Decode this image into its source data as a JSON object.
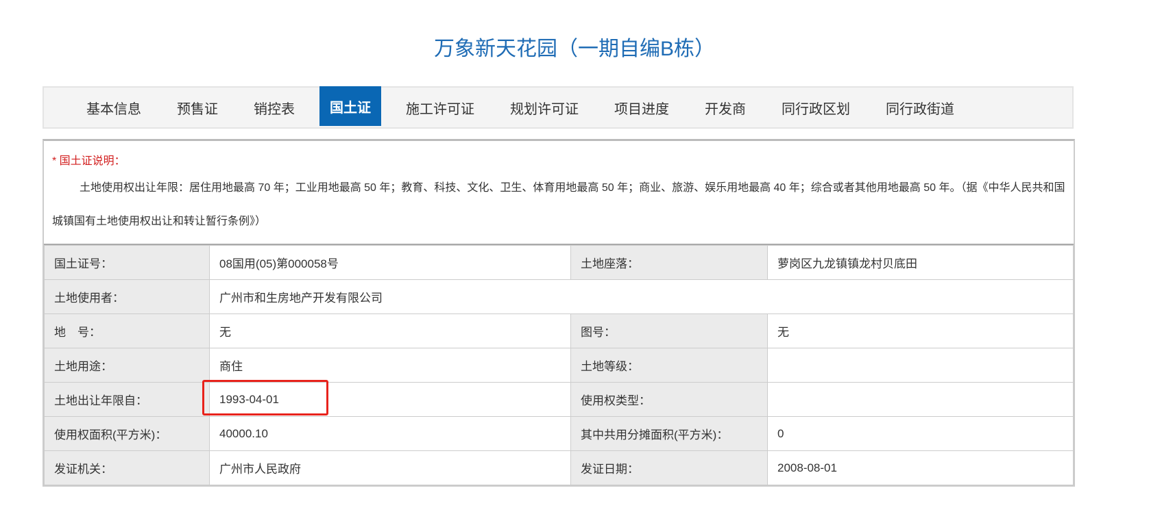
{
  "title": "万象新天花园（一期自编B栋）",
  "tabs": [
    "基本信息",
    "预售证",
    "销控表",
    "国土证",
    "施工许可证",
    "规划许可证",
    "项目进度",
    "开发商",
    "同行政区划",
    "同行政街道"
  ],
  "active_tab": "国土证",
  "note": {
    "heading": "* 国土证说明：",
    "body": "土地使用权出让年限：居住用地最高 70 年；工业用地最高 50 年；教育、科技、文化、卫生、体育用地最高 50 年；商业、旅游、娱乐用地最高 40 年；综合或者其他用地最高 50 年。（据《中华人民共和国城镇国有土地使用权出让和转让暂行条例》）"
  },
  "fields": {
    "cert_no": {
      "label": "国土证号：",
      "value": "08国用(05)第000058号"
    },
    "location": {
      "label": "土地座落：",
      "value": "萝岗区九龙镇镇龙村贝底田"
    },
    "user": {
      "label": "土地使用者：",
      "value": "广州市和生房地产开发有限公司"
    },
    "lot_no": {
      "label": "地　号：",
      "value": "无"
    },
    "map_no": {
      "label": "图号：",
      "value": "无"
    },
    "usage": {
      "label": "土地用途：",
      "value": "商住"
    },
    "grade": {
      "label": "土地等级：",
      "value": ""
    },
    "term_from": {
      "label": "土地出让年限自：",
      "value": "1993-04-01"
    },
    "right_type": {
      "label": "使用权类型：",
      "value": ""
    },
    "area": {
      "label": "使用权面积(平方米)：",
      "value": "40000.10"
    },
    "shared_area": {
      "label": "其中共用分摊面积(平方米)：",
      "value": "0"
    },
    "issuer": {
      "label": "发证机关：",
      "value": "广州市人民政府"
    },
    "issue_date": {
      "label": "发证日期：",
      "value": "2008-08-01"
    }
  },
  "colors": {
    "accent": "#0a67b4",
    "highlight": "#e8231c"
  }
}
